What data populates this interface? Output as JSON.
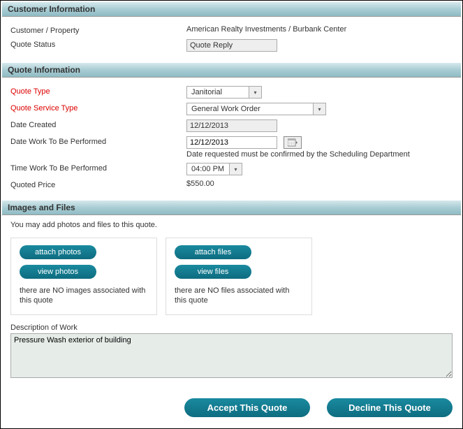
{
  "sections": {
    "customer": {
      "title": "Customer Information",
      "fields": {
        "customer_property": {
          "label": "Customer / Property",
          "value": "American Realty Investments / Burbank Center"
        },
        "quote_status": {
          "label": "Quote Status",
          "value": "Quote Reply"
        }
      }
    },
    "quote": {
      "title": "Quote Information",
      "fields": {
        "quote_type": {
          "label": "Quote Type",
          "value": "Janitorial"
        },
        "quote_service_type": {
          "label": "Quote Service Type",
          "value": "General Work Order"
        },
        "date_created": {
          "label": "Date Created",
          "value": "12/12/2013"
        },
        "date_work": {
          "label": "Date Work To Be Performed",
          "value": "12/12/2013",
          "helper": "Date requested must be confirmed by the Scheduling Department"
        },
        "time_work": {
          "label": "Time Work To Be Performed",
          "value": "04:00 PM"
        },
        "quoted_price": {
          "label": "Quoted Price",
          "value": "$550.00"
        }
      }
    },
    "images_files": {
      "title": "Images and Files",
      "intro": "You may add photos and files to this quote.",
      "photos": {
        "attach_label": "attach photos",
        "view_label": "view photos",
        "status": "there are NO images associated with this quote"
      },
      "files": {
        "attach_label": "attach files",
        "view_label": "view files",
        "status": "there are NO files associated with this quote"
      },
      "description": {
        "label": "Description of Work",
        "value": "Pressure Wash exterior of building"
      }
    }
  },
  "actions": {
    "accept": "Accept This Quote",
    "decline": "Decline This Quote"
  }
}
